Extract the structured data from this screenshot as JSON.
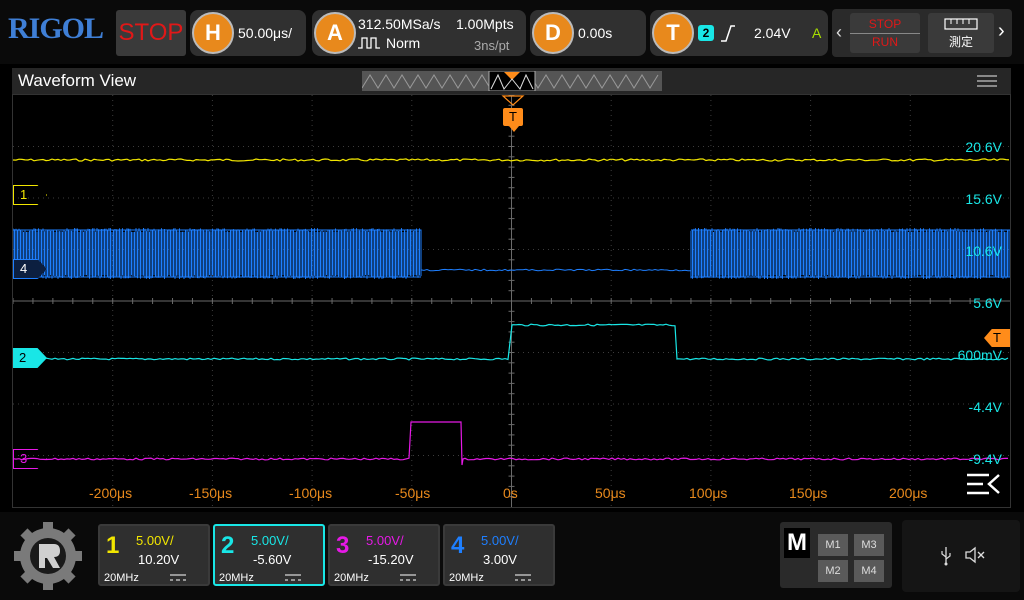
{
  "brand": "RIGOL",
  "run_state": "STOP",
  "horizontal": {
    "icon": "H",
    "scale": "50.00μs/"
  },
  "acquire": {
    "icon": "A",
    "sample_rate": "312.50MSa/s",
    "memory_depth": "1.00Mpts",
    "mode": "Norm",
    "resolution": "3ns/pt"
  },
  "delay": {
    "icon": "D",
    "value": "0.00s"
  },
  "trigger": {
    "icon": "T",
    "source": "2",
    "slope": "rising",
    "level": "2.04V",
    "mode": "A"
  },
  "controls": {
    "run_stop_top": "STOP",
    "run_stop_bottom": "RUN",
    "measure_label": "測定"
  },
  "waveform_view": {
    "title": "Waveform View"
  },
  "scale_labels": [
    "20.6V",
    "15.6V",
    "10.6V",
    "5.6V",
    "600mV",
    "-4.4V",
    "-9.4V"
  ],
  "time_labels": [
    "-200μs",
    "-150μs",
    "-100μs",
    "-50μs",
    "0s",
    "50μs",
    "100μs",
    "150μs",
    "200μs"
  ],
  "trigger_marker": "T",
  "channel_markers": [
    "1",
    "4",
    "2",
    "3"
  ],
  "channels": [
    {
      "num": "1",
      "scale": "5.00V/",
      "offset": "10.20V",
      "bandwidth": "20MHz",
      "color": "#f2e600"
    },
    {
      "num": "2",
      "scale": "5.00V/",
      "offset": "-5.60V",
      "bandwidth": "20MHz",
      "color": "#19e6e6"
    },
    {
      "num": "3",
      "scale": "5.00V/",
      "offset": "-15.20V",
      "bandwidth": "20MHz",
      "color": "#e619e6"
    },
    {
      "num": "4",
      "scale": "5.00V/",
      "offset": "3.00V",
      "bandwidth": "20MHz",
      "color": "#1e7fff"
    }
  ],
  "math": {
    "label": "M",
    "items": [
      "M1",
      "M3",
      "M2",
      "M4"
    ]
  },
  "colors": {
    "ch1": "#f2e600",
    "ch2": "#19e6e6",
    "ch3": "#e619e6",
    "ch4": "#1e7fff",
    "trigger": "#ff8c1a",
    "stop": "#e01818",
    "accent": "#e8891c"
  }
}
